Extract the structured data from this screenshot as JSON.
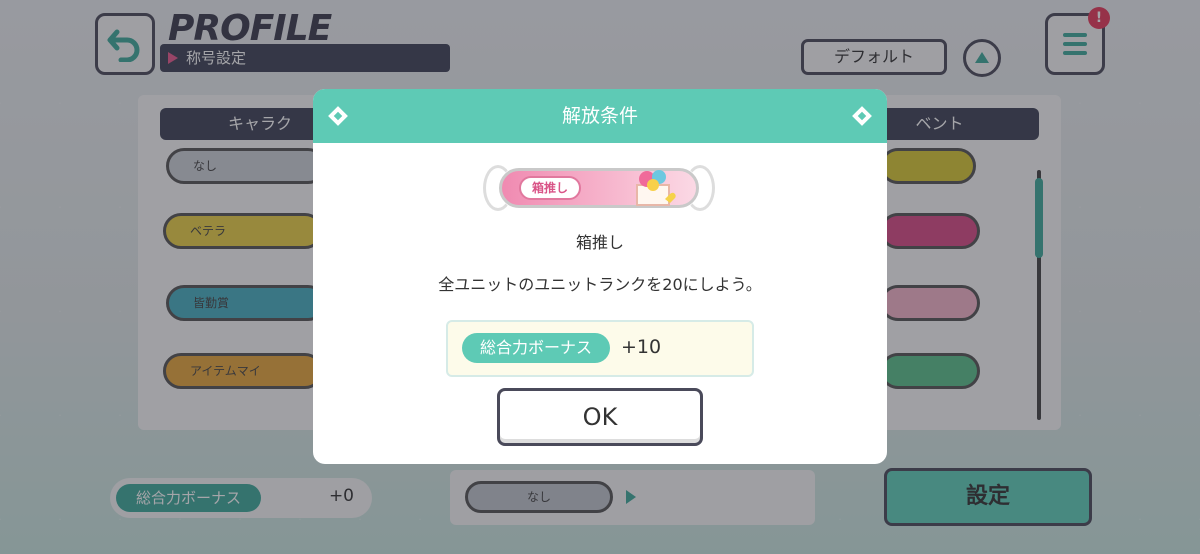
{
  "header": {
    "back_icon": "back-arrow-icon",
    "title": "PROFILE",
    "subtitle": "称号設定",
    "default_button": "デフォルト",
    "menu_icon": "hamburger-menu-icon",
    "notification_badge": "!"
  },
  "panel": {
    "tab_left_label": "キャラク",
    "tab_right_label": "ベント",
    "items_left": [
      "なし",
      "ベテラ",
      "皆勤賞",
      "アイテムマイ"
    ]
  },
  "footer": {
    "bonus_label": "総合力ボーナス",
    "bonus_value": "+0",
    "current_title": "なし",
    "set_button": "設定"
  },
  "modal": {
    "title": "解放条件",
    "badge_text": "箱推し",
    "title_name": "箱推し",
    "condition": "全ユニットのユニットランクを20にしよう。",
    "bonus_label": "総合力ボーナス",
    "bonus_value": "+10",
    "ok_button": "OK"
  },
  "colors": {
    "accent_teal": "#5ecab5",
    "dark_navy": "#3e4356",
    "badge_pink": "#f08ab1"
  }
}
